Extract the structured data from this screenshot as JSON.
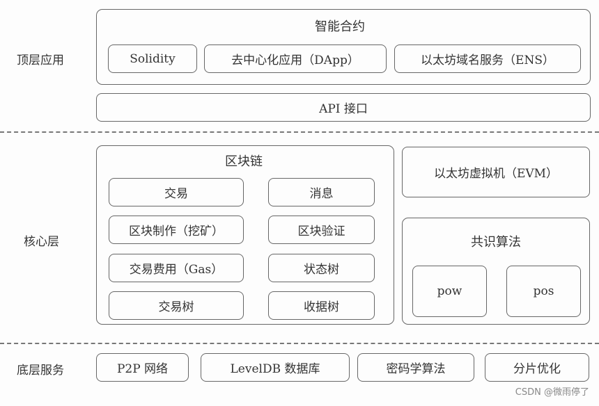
{
  "layers": {
    "top": {
      "label": "顶层应用",
      "smart_contract": {
        "title": "智能合约",
        "items": [
          "Solidity",
          "去中心化应用（DApp）",
          "以太坊域名服务（ENS）"
        ]
      },
      "api": "API 接口"
    },
    "core": {
      "label": "核心层",
      "blockchain": {
        "title": "区块链",
        "left_items": [
          "交易",
          "区块制作（挖矿）",
          "交易费用（Gas）",
          "交易树"
        ],
        "right_items": [
          "消息",
          "区块验证",
          "状态树",
          "收据树"
        ]
      },
      "evm": "以太坊虚拟机（EVM）",
      "consensus": {
        "title": "共识算法",
        "items": [
          "pow",
          "pos"
        ]
      }
    },
    "bottom": {
      "label": "底层服务",
      "items": [
        "P2P 网络",
        "LevelDB 数据库",
        "密码学算法",
        "分片优化"
      ]
    }
  },
  "watermark": "CSDN @微雨停了"
}
